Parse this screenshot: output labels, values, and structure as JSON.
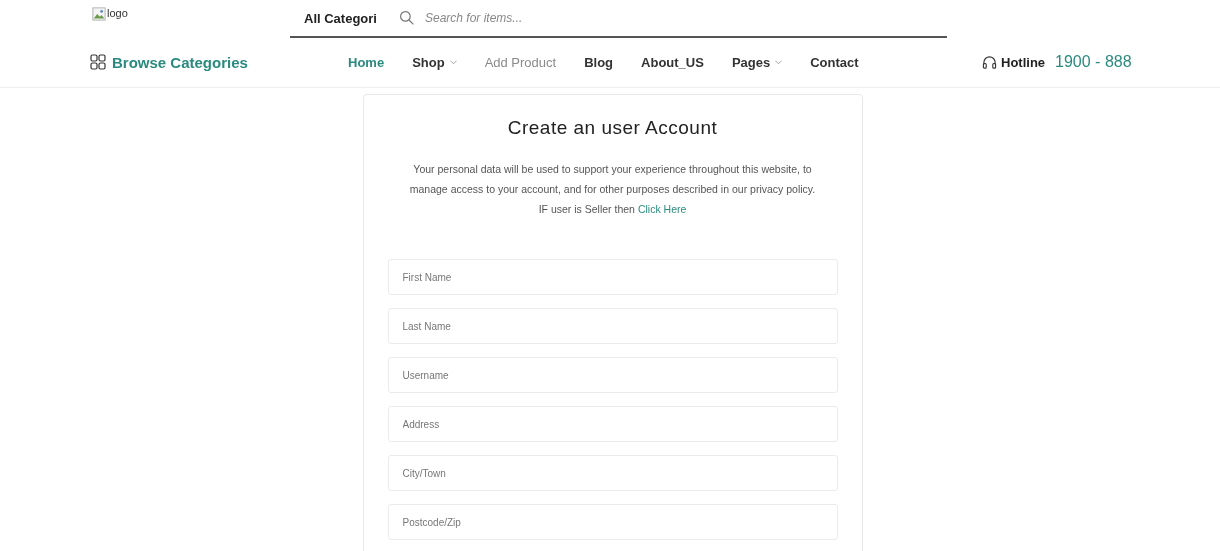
{
  "header": {
    "logo_alt": "logo",
    "category_select": "All Categori",
    "search": {
      "placeholder": "Search for items..."
    }
  },
  "nav": {
    "browse": "Browse Categories",
    "items": [
      {
        "label": "Home",
        "selected": true,
        "dropdown": false,
        "disabled": false
      },
      {
        "label": "Shop",
        "selected": false,
        "dropdown": true,
        "disabled": false
      },
      {
        "label": "Add Product",
        "selected": false,
        "dropdown": false,
        "disabled": true
      },
      {
        "label": "Blog",
        "selected": false,
        "dropdown": false,
        "disabled": false
      },
      {
        "label": "About_US",
        "selected": false,
        "dropdown": false,
        "disabled": false
      },
      {
        "label": "Pages",
        "selected": false,
        "dropdown": true,
        "disabled": false
      },
      {
        "label": "Contact",
        "selected": false,
        "dropdown": false,
        "disabled": false
      }
    ],
    "hotline_label": "Hotline",
    "hotline_number": "1900 - 888"
  },
  "form": {
    "title": "Create an user Account",
    "intro": "Your personal data will be used to support your experience throughout this website, to manage access to your account, and for other purposes described in our privacy policy.",
    "seller_note": "IF user is Seller then",
    "seller_link": "Click Here",
    "fields": [
      {
        "placeholder": "First Name"
      },
      {
        "placeholder": "Last Name"
      },
      {
        "placeholder": "Username"
      },
      {
        "placeholder": "Address"
      },
      {
        "placeholder": "City/Town"
      },
      {
        "placeholder": "Postcode/Zip"
      }
    ]
  }
}
